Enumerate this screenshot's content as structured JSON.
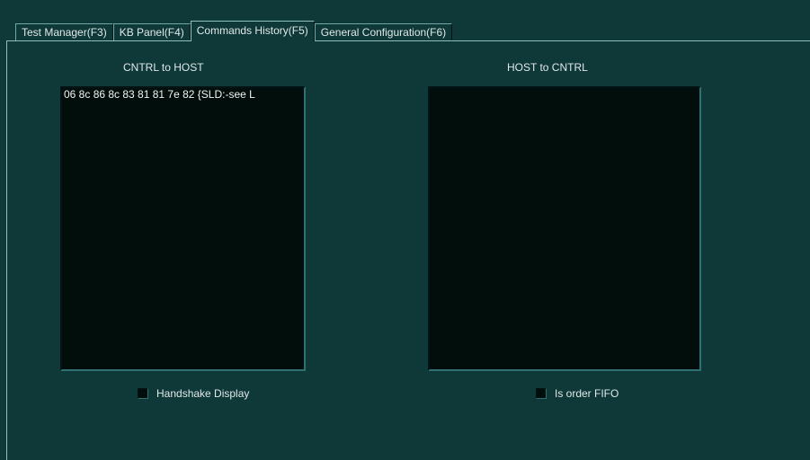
{
  "tabs": [
    {
      "label": "Test Manager(F3)"
    },
    {
      "label": "KB Panel(F4)"
    },
    {
      "label": "Commands History(F5)"
    },
    {
      "label": "General Configuration(F6)"
    }
  ],
  "active_tab": "Commands History(F5)",
  "cntrl_to_host": {
    "caption": "CNTRL to HOST",
    "rows": [
      "06 8c 86 8c 83 81 81 7e 82   {SLD:-see L"
    ],
    "checkbox_label": "Handshake Display",
    "checked": false
  },
  "host_to_cntrl": {
    "caption": "HOST to CNTRL",
    "rows": [],
    "checkbox_label": "Is order  FIFO",
    "checked": false
  },
  "colors": {
    "background": "#0f3838",
    "list_background": "#020e0b",
    "text": "#e0e8e8"
  }
}
